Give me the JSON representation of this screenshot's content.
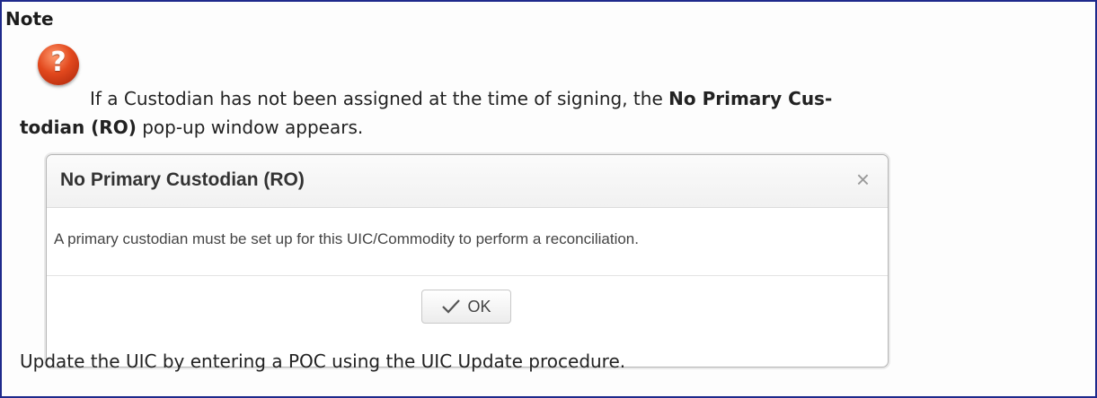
{
  "note": {
    "title": "Note",
    "icon": "help-question-icon",
    "paragraph": {
      "text_before": "If a Custodian has not been assigned at the time of signing, the ",
      "bold_line1": "No Primary Cus-",
      "bold_line2": "todian (RO)",
      "text_after": " pop-up window appears."
    },
    "footer_text": "Update the UIC by entering a POC using the UIC Update procedure."
  },
  "dialog": {
    "title": "No Primary Custodian (RO)",
    "close_glyph": "×",
    "message": "A primary custodian must be set up for this UIC/Commodity to perform a reconciliation.",
    "ok_label": "OK",
    "ok_icon": "checkmark-icon"
  },
  "colors": {
    "border": "#1f2a8c",
    "icon": "#e2481d"
  }
}
